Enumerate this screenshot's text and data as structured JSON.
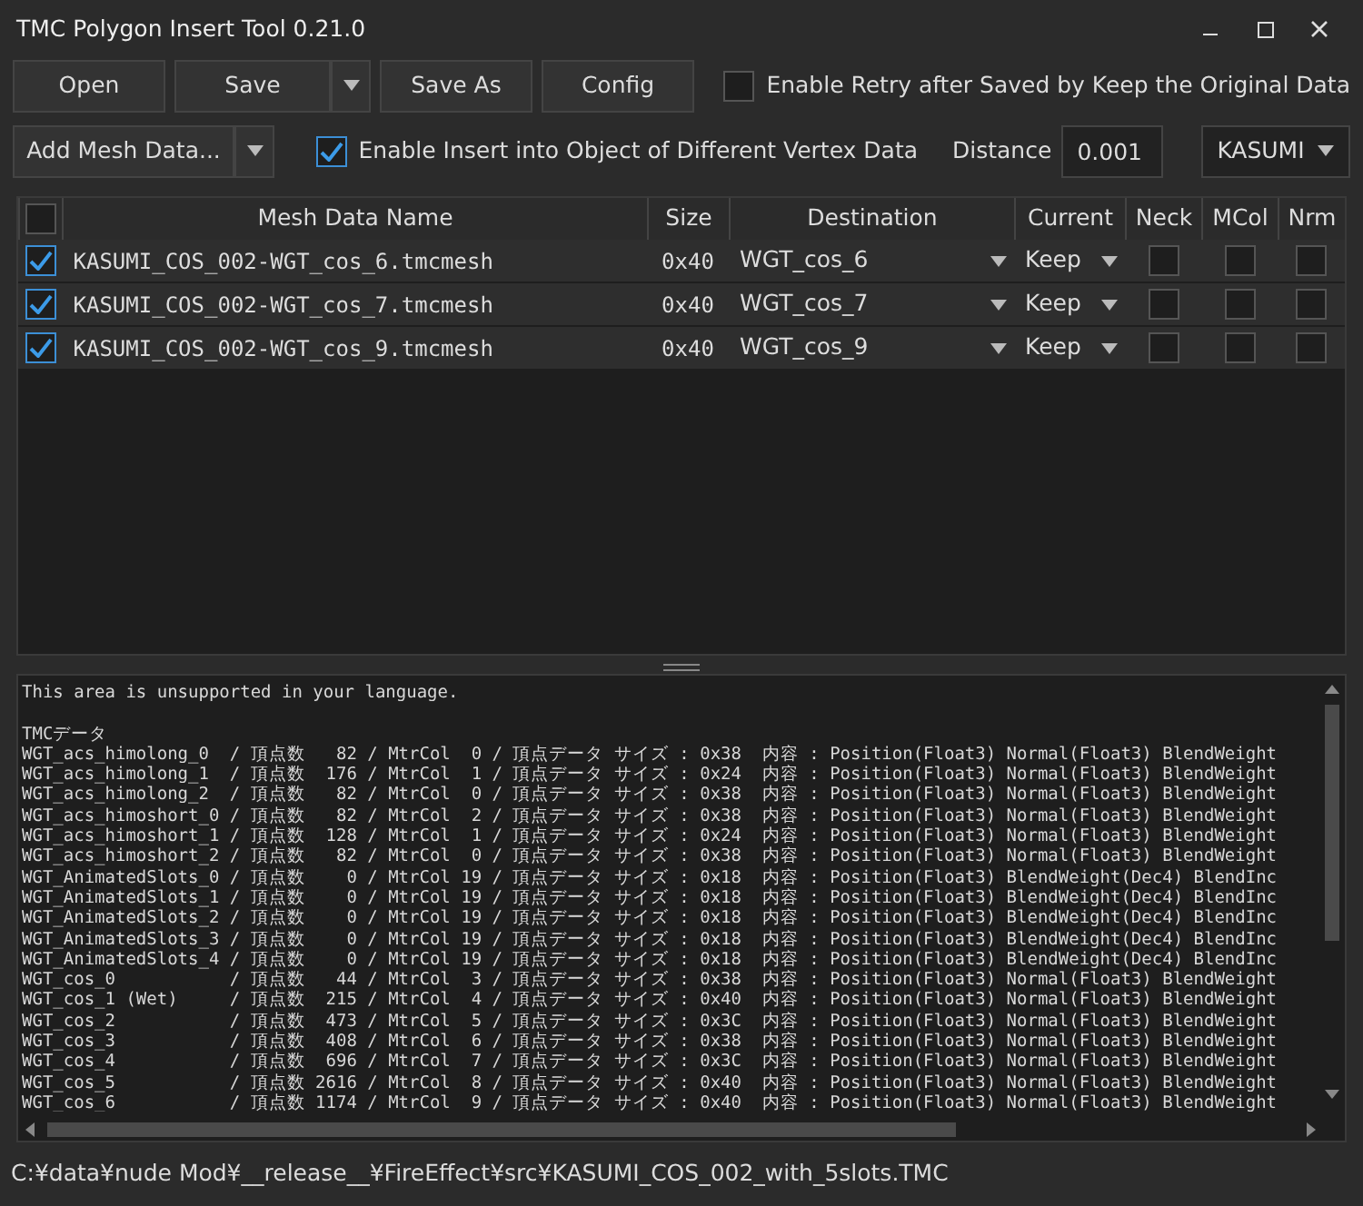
{
  "window": {
    "title": "TMC Polygon Insert Tool 0.21.0"
  },
  "toolbar": {
    "buttons": [
      {
        "label": "Open",
        "kind": "plain"
      },
      {
        "label": "Save",
        "kind": "split"
      },
      {
        "label": "Save As",
        "kind": "plain"
      },
      {
        "label": "Config",
        "kind": "plain"
      }
    ],
    "retry_option": {
      "label": "Enable Retry after Saved by Keep the Original Data",
      "checked": false
    }
  },
  "options": {
    "add_button": {
      "label": "Add Mesh Data..."
    },
    "insert_option": {
      "label": "Enable Insert into Object of Different Vertex Data",
      "checked": true
    },
    "distance": {
      "label": "Distance",
      "value": "0.001"
    },
    "character": {
      "value": "KASUMI"
    }
  },
  "table": {
    "select_all": {
      "checked": false
    },
    "columns": [
      "Mesh Data Name",
      "Size",
      "Destination",
      "Current",
      "Neck",
      "MCol",
      "Nrm"
    ],
    "rows": [
      {
        "checked": true,
        "name": "KASUMI_COS_002-WGT_cos_6.tmcmesh",
        "size": "0x40",
        "destination": "WGT_cos_6",
        "current": "Keep",
        "neck": false,
        "mcol": false,
        "nrm": false
      },
      {
        "checked": true,
        "name": "KASUMI_COS_002-WGT_cos_7.tmcmesh",
        "size": "0x40",
        "destination": "WGT_cos_7",
        "current": "Keep",
        "neck": false,
        "mcol": false,
        "nrm": false
      },
      {
        "checked": true,
        "name": "KASUMI_COS_002-WGT_cos_9.tmcmesh",
        "size": "0x40",
        "destination": "WGT_cos_9",
        "current": "Keep",
        "neck": false,
        "mcol": false,
        "nrm": false
      }
    ]
  },
  "log": {
    "notice": "This area is unsupported in your language.",
    "lines": [
      "TMCデータ",
      "WGT_acs_himolong_0  / 頂点数   82 / MtrCol  0 / 頂点データ サイズ : 0x38  内容 : Position(Float3) Normal(Float3) BlendWeight",
      "WGT_acs_himolong_1  / 頂点数  176 / MtrCol  1 / 頂点データ サイズ : 0x24  内容 : Position(Float3) Normal(Float3) BlendWeight",
      "WGT_acs_himolong_2  / 頂点数   82 / MtrCol  0 / 頂点データ サイズ : 0x38  内容 : Position(Float3) Normal(Float3) BlendWeight",
      "WGT_acs_himoshort_0 / 頂点数   82 / MtrCol  2 / 頂点データ サイズ : 0x38  内容 : Position(Float3) Normal(Float3) BlendWeight",
      "WGT_acs_himoshort_1 / 頂点数  128 / MtrCol  1 / 頂点データ サイズ : 0x24  内容 : Position(Float3) Normal(Float3) BlendWeight",
      "WGT_acs_himoshort_2 / 頂点数   82 / MtrCol  0 / 頂点データ サイズ : 0x38  内容 : Position(Float3) Normal(Float3) BlendWeight",
      "WGT_AnimatedSlots_0 / 頂点数    0 / MtrCol 19 / 頂点データ サイズ : 0x18  内容 : Position(Float3) BlendWeight(Dec4) BlendInc",
      "WGT_AnimatedSlots_1 / 頂点数    0 / MtrCol 19 / 頂点データ サイズ : 0x18  内容 : Position(Float3) BlendWeight(Dec4) BlendInc",
      "WGT_AnimatedSlots_2 / 頂点数    0 / MtrCol 19 / 頂点データ サイズ : 0x18  内容 : Position(Float3) BlendWeight(Dec4) BlendInc",
      "WGT_AnimatedSlots_3 / 頂点数    0 / MtrCol 19 / 頂点データ サイズ : 0x18  内容 : Position(Float3) BlendWeight(Dec4) BlendInc",
      "WGT_AnimatedSlots_4 / 頂点数    0 / MtrCol 19 / 頂点データ サイズ : 0x18  内容 : Position(Float3) BlendWeight(Dec4) BlendInc",
      "WGT_cos_0           / 頂点数   44 / MtrCol  3 / 頂点データ サイズ : 0x38  内容 : Position(Float3) Normal(Float3) BlendWeight",
      "WGT_cos_1 (Wet)     / 頂点数  215 / MtrCol  4 / 頂点データ サイズ : 0x40  内容 : Position(Float3) Normal(Float3) BlendWeight",
      "WGT_cos_2           / 頂点数  473 / MtrCol  5 / 頂点データ サイズ : 0x3C  内容 : Position(Float3) Normal(Float3) BlendWeight",
      "WGT_cos_3           / 頂点数  408 / MtrCol  6 / 頂点データ サイズ : 0x38  内容 : Position(Float3) Normal(Float3) BlendWeight",
      "WGT_cos_4           / 頂点数  696 / MtrCol  7 / 頂点データ サイズ : 0x3C  内容 : Position(Float3) Normal(Float3) BlendWeight",
      "WGT_cos_5           / 頂点数 2616 / MtrCol  8 / 頂点データ サイズ : 0x40  内容 : Position(Float3) Normal(Float3) BlendWeight",
      "WGT_cos_6           / 頂点数 1174 / MtrCol  9 / 頂点データ サイズ : 0x40  内容 : Position(Float3) Normal(Float3) BlendWeight"
    ]
  },
  "status_bar": {
    "path": "C:¥data¥nude Mod¥__release__¥FireEffect¥src¥KASUMI_COS_002_with_5slots.TMC"
  }
}
